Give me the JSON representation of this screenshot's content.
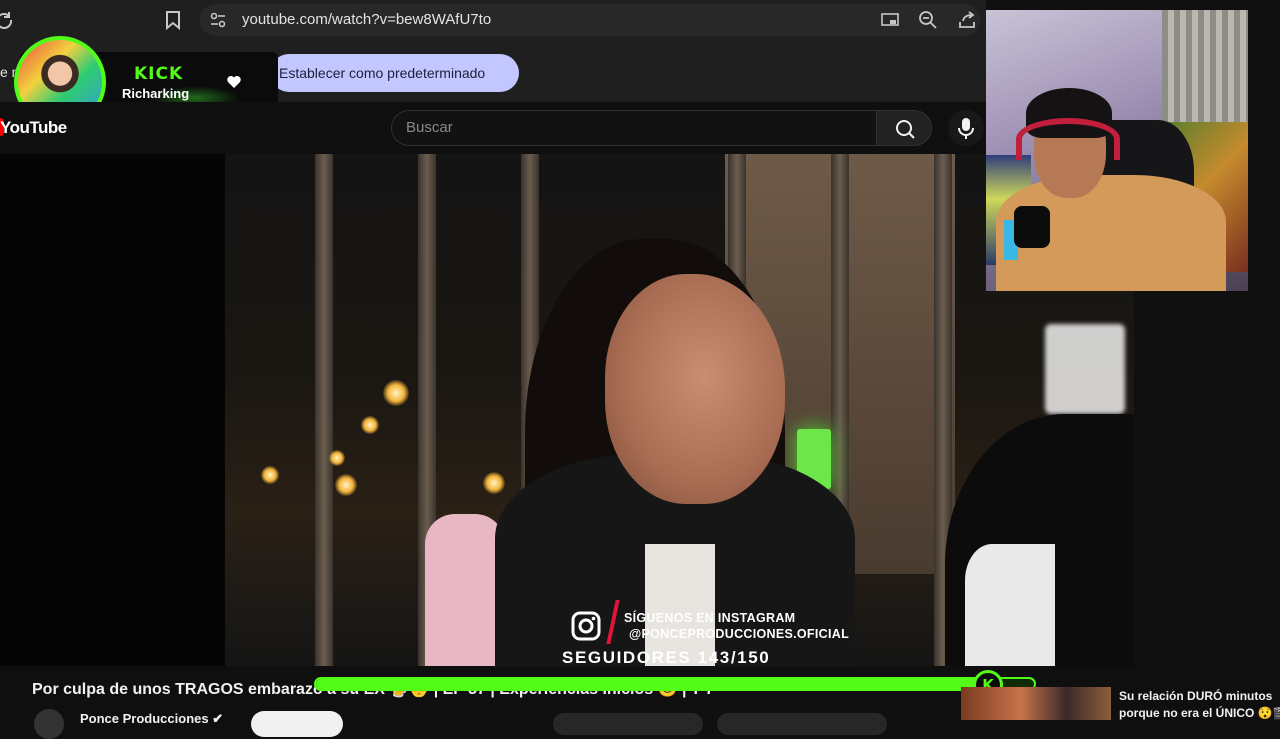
{
  "browser": {
    "url": "youtube.com/watch?v=bew8WAfU7to",
    "default_prompt_partial": "e n",
    "set_default_label": "Establecer como predeterminado",
    "icons": [
      "reload-icon",
      "bookmark-icon",
      "site-info-icon",
      "cast-icon",
      "zoom-icon",
      "share-icon"
    ]
  },
  "kick_overlay": {
    "brand": "KICK",
    "username": "Richarking",
    "icons": [
      "heart-icon"
    ],
    "accent": "#53fc18"
  },
  "youtube": {
    "logo": "YouTube",
    "search_placeholder": "Buscar",
    "icons": [
      "search-icon",
      "mic-icon"
    ]
  },
  "video_overlay": {
    "instagram_line1": "SÍGUENOS EN INSTAGRAM",
    "instagram_line2": "@PONCEPRODUCCIONES.OFICIAL",
    "followers": "SEGUIDORES 143/150",
    "followers_current": 143,
    "followers_goal": 150
  },
  "video_info": {
    "title": "Por culpa de unos TRAGOS embarazó a su EX 🍺👶 | EP 37 | Experiencias Inicios 😊 | T 7",
    "channel": "Ponce Producciones ✔"
  },
  "recommendation": {
    "line1": "Su relación DURÓ minutos",
    "line2": "porque no era el ÚNICO 😯🎬"
  }
}
